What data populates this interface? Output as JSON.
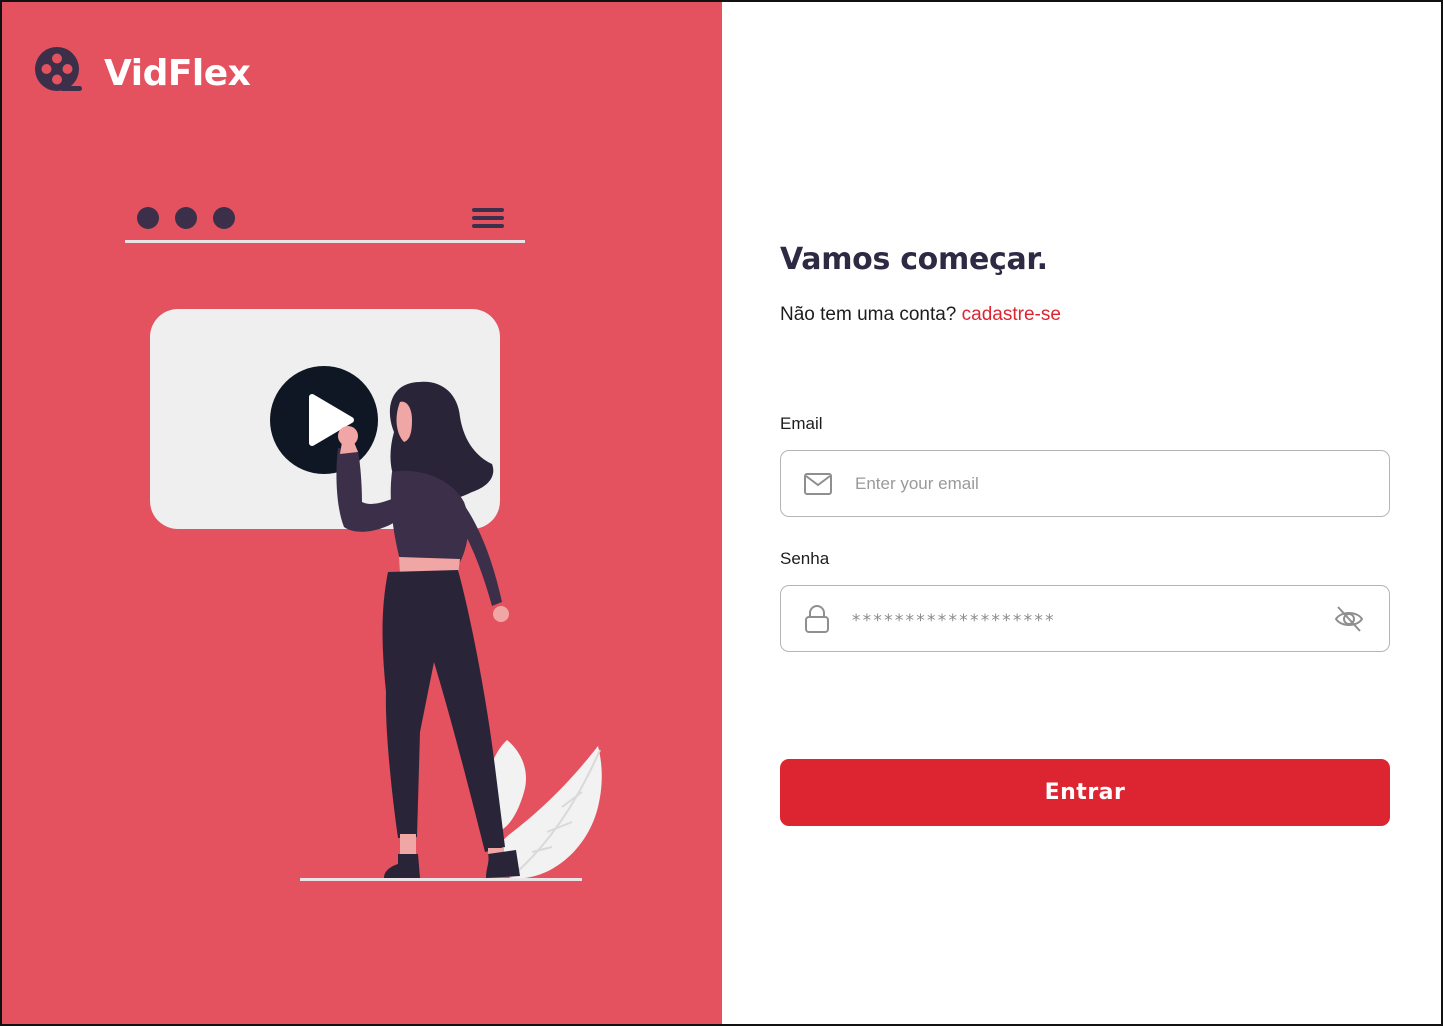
{
  "brand": {
    "name": "VidFlex",
    "logo_icon": "film-reel-icon"
  },
  "colors": {
    "brand_red": "#e4515f",
    "accent_red": "#dc2531",
    "heading_dark": "#2f2a44",
    "illustration_dark": "#2a2438",
    "screen_light": "#efefef"
  },
  "auth": {
    "heading": "Vamos começar.",
    "no_account_text": "Não tem uma conta?",
    "signup_link": "cadastre-se",
    "email": {
      "label": "Email",
      "placeholder": "Enter your email",
      "icon": "mail-icon"
    },
    "password": {
      "label": "Senha",
      "masked_value": "*******************",
      "icon": "lock-icon",
      "toggle_icon": "eye-off-icon"
    },
    "submit_label": "Entrar"
  }
}
